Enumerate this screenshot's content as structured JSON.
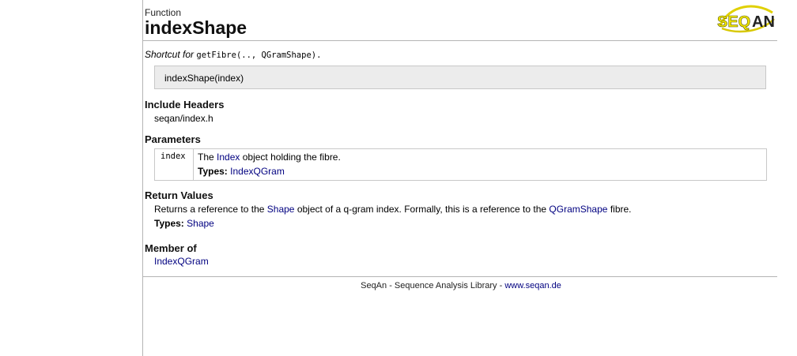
{
  "header": {
    "kind": "Function",
    "title": "indexShape",
    "logo_text": "SEQAN"
  },
  "summary": {
    "prefix": "Shortcut for",
    "code": "getFibre(.., QGramShape)."
  },
  "signature": "indexShape(index)",
  "include_headers": {
    "heading": "Include Headers",
    "value": "seqan/index.h"
  },
  "parameters": {
    "heading": "Parameters",
    "rows": [
      {
        "name": "index",
        "desc_before": "The",
        "desc_link": "Index",
        "desc_after": "object holding the fibre.",
        "types_label": "Types:",
        "types_link": "IndexQGram"
      }
    ]
  },
  "return_values": {
    "heading": "Return Values",
    "text_before": "Returns a reference to the",
    "link1": "Shape",
    "text_middle": "object of a q-gram index. Formally, this is a reference to the",
    "link2": "QGramShape",
    "text_after": "fibre.",
    "types_label": "Types:",
    "types_link": "Shape"
  },
  "member_of": {
    "heading": "Member of",
    "link": "IndexQGram"
  },
  "footer": {
    "text": "SeqAn - Sequence Analysis Library -",
    "link": "www.seqan.de"
  },
  "colors": {
    "link": "#000080",
    "signature_bg": "#ececec",
    "logo_yellow": "#f2e600"
  }
}
